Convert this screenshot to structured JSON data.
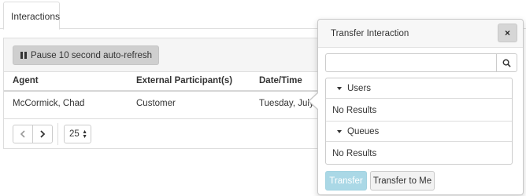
{
  "tabs": {
    "interactions_label": "Interactions"
  },
  "toolbar": {
    "pause_label": "Pause 10 second auto-refresh"
  },
  "table": {
    "columns": [
      "Agent",
      "External Participant(s)",
      "Date/Time"
    ],
    "rows": [
      {
        "agent": "McCormick, Chad",
        "external": "Customer",
        "datetime": "Tuesday, July"
      }
    ]
  },
  "pager": {
    "prev_icon": "chevron-left-icon",
    "next_icon": "chevron-right-icon",
    "page_size": "25"
  },
  "transfer_popover": {
    "title": "Transfer Interaction",
    "close_label": "×",
    "search_value": "",
    "search_icon": "search-icon",
    "groups": [
      {
        "label": "Users",
        "empty_text": "No Results"
      },
      {
        "label": "Queues",
        "empty_text": "No Results"
      }
    ],
    "transfer_label": "Transfer",
    "transfer_to_me_label": "Transfer to Me"
  },
  "colors": {
    "transfer_button": "#aad8e6",
    "header_bg": "#f5f5f5",
    "pause_button": "#cfcfcf"
  }
}
